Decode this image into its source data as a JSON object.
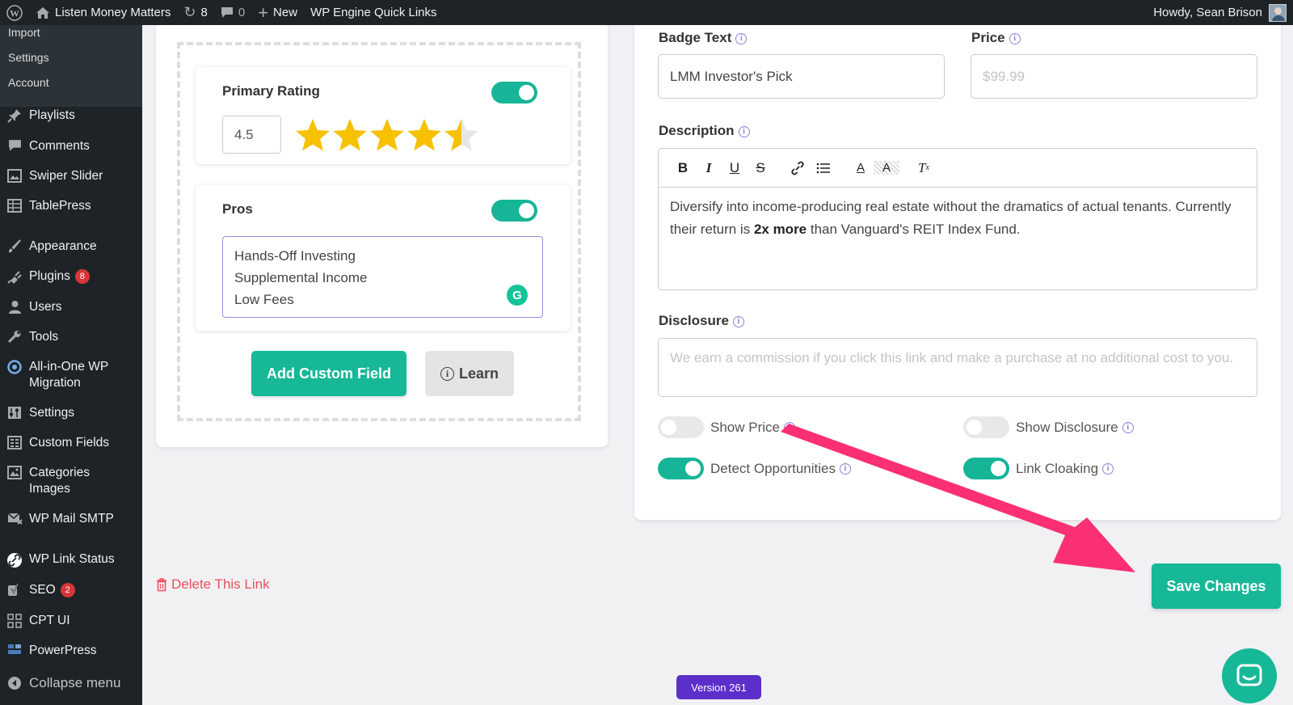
{
  "adminbar": {
    "site_name": "Listen Money Matters",
    "updates_count": "8",
    "comments_count": "0",
    "new_label": "New",
    "quick_links_label": "WP Engine Quick Links",
    "howdy": "Howdy, Sean Brison"
  },
  "sidebar": {
    "submenu": [
      "Import",
      "Settings",
      "Account"
    ],
    "items": [
      {
        "label": "Playlists",
        "icon": "pin-icon"
      },
      {
        "label": "Comments",
        "icon": "comment-icon"
      },
      {
        "label": "Swiper Slider",
        "icon": "slider-icon"
      },
      {
        "label": "TablePress",
        "icon": "table-icon"
      },
      {
        "label": "Appearance",
        "icon": "brush-icon"
      },
      {
        "label": "Plugins",
        "icon": "plugin-icon",
        "badge": "8"
      },
      {
        "label": "Users",
        "icon": "user-icon"
      },
      {
        "label": "Tools",
        "icon": "wrench-icon"
      },
      {
        "label": "All-in-One WP Migration",
        "icon": "migration-icon"
      },
      {
        "label": "Settings",
        "icon": "settings-icon"
      },
      {
        "label": "Custom Fields",
        "icon": "fields-icon"
      },
      {
        "label": "Categories Images",
        "icon": "image-icon"
      },
      {
        "label": "WP Mail SMTP",
        "icon": "mail-icon"
      },
      {
        "label": "WP Link Status",
        "icon": "link-icon"
      },
      {
        "label": "SEO",
        "icon": "seo-icon",
        "badge": "2"
      },
      {
        "label": "CPT UI",
        "icon": "grid-icon"
      },
      {
        "label": "PowerPress",
        "icon": "podcast-icon"
      },
      {
        "label": "Collapse menu",
        "icon": "collapse-icon"
      }
    ]
  },
  "left": {
    "primary_rating": {
      "title": "Primary Rating",
      "value": "4.5",
      "stars_filled": 4.5,
      "stars_total": 5,
      "enabled": true
    },
    "pros": {
      "title": "Pros",
      "enabled": true,
      "lines": [
        "Hands-Off Investing",
        "Supplemental Income",
        "Low Fees"
      ]
    },
    "add_custom_field_label": "Add Custom Field",
    "learn_label": "Learn"
  },
  "right": {
    "badge_text_label": "Badge Text",
    "badge_text_value": "LMM Investor's Pick",
    "price_label": "Price",
    "price_placeholder": "$99.99",
    "description_label": "Description",
    "description_pre": "Diversify into income-producing real estate without the dramatics of actual tenants. Currently their return is ",
    "description_bold": "2x more",
    "description_post": " than Vanguard's REIT Index Fund.",
    "disclosure_label": "Disclosure",
    "disclosure_placeholder": "We earn a commission if you click this link and make a purchase at no additional cost to you.",
    "switches": {
      "show_price": {
        "label": "Show Price",
        "on": false
      },
      "show_disclosure": {
        "label": "Show Disclosure",
        "on": false
      },
      "detect_opportunities": {
        "label": "Detect Opportunities",
        "on": true
      },
      "link_cloaking": {
        "label": "Link Cloaking",
        "on": true
      }
    }
  },
  "footer": {
    "delete_label": "Delete This Link",
    "save_label": "Save Changes",
    "version": "Version 261"
  },
  "colors": {
    "accent_green": "#17b897",
    "arrow_pink": "#fb2f74",
    "delete_red": "#e7505a",
    "version_purple": "#5b2fc9"
  }
}
